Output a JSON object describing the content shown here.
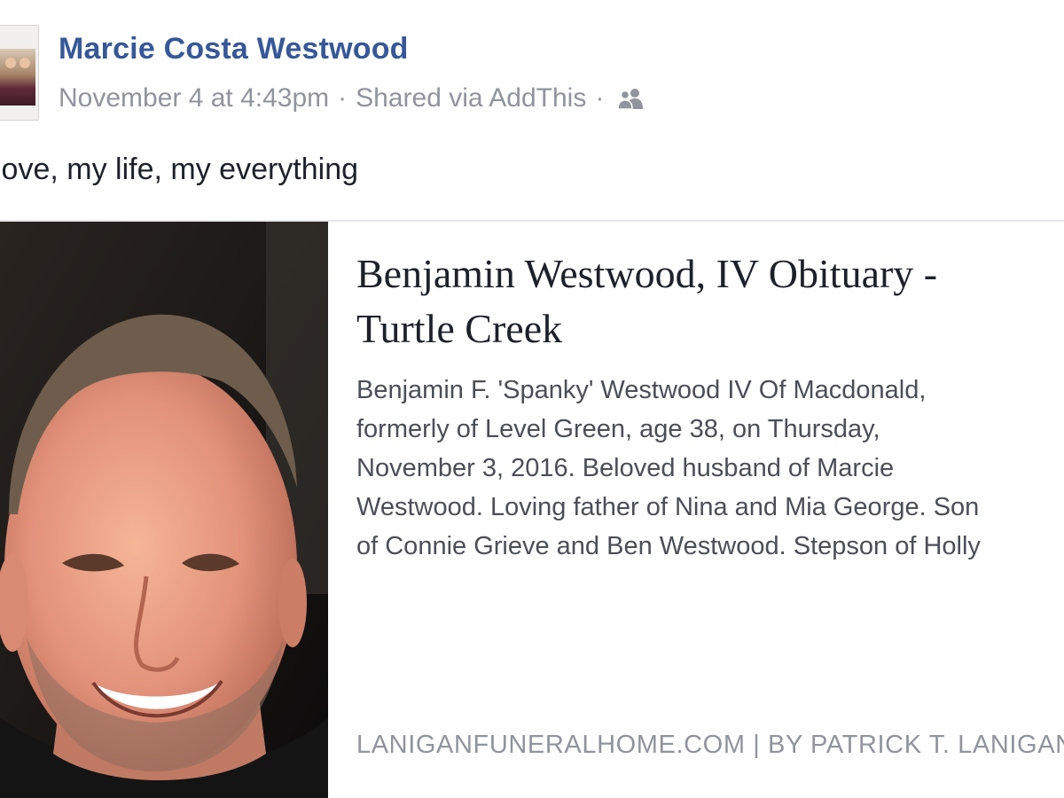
{
  "post": {
    "author": "Marcie Costa Westwood",
    "timestamp": "November 4 at 4:43pm",
    "separator": "·",
    "shared_via": "Shared via AddThis",
    "audience_icon": "friends-icon",
    "message": "love, my life, my everything"
  },
  "link_preview": {
    "title_line1": "Benjamin Westwood, IV Obituary -",
    "title_line2": "Turtle Creek",
    "description_lines": [
      "Benjamin F. 'Spanky' Westwood IV Of Macdonald,",
      "formerly of Level Green, age 38, on Thursday,",
      "November 3, 2016. Beloved husband of Marcie",
      "Westwood. Loving father of Nina and Mia George. Son",
      "of Connie Grieve and Ben Westwood. Stepson of Holly"
    ],
    "caption": "LANIGANFUNERALHOME.COM  |  BY PATRICK T. LANIGAN"
  },
  "colors": {
    "author_link": "#365899",
    "meta_text": "#90949c",
    "body_text": "#1d2129",
    "description_text": "#4b4f56"
  }
}
